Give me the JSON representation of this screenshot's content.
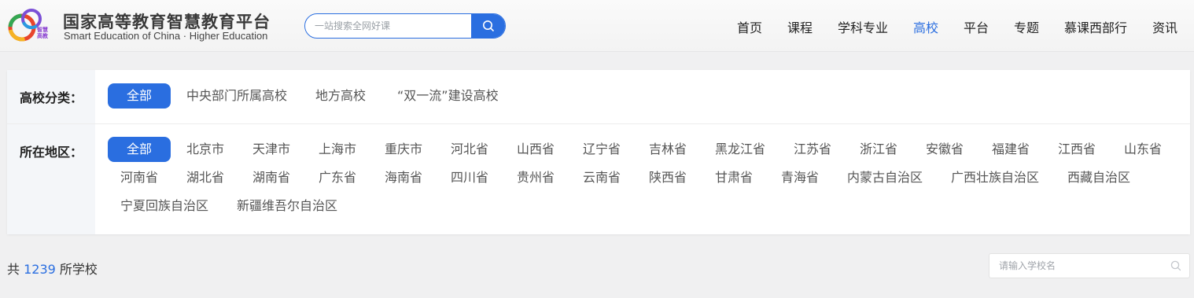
{
  "brand": {
    "title_cn": "国家高等教育智慧教育平台",
    "title_en": "Smart Education of China · Higher Education",
    "logo_text_line1": "智慧",
    "logo_text_line2": "高教"
  },
  "search": {
    "placeholder": "一站搜索全网好课"
  },
  "nav": {
    "items": [
      {
        "label": "首页"
      },
      {
        "label": "课程"
      },
      {
        "label": "学科专业"
      },
      {
        "label": "高校"
      },
      {
        "label": "平台"
      },
      {
        "label": "专题"
      },
      {
        "label": "慕课西部行"
      },
      {
        "label": "资讯"
      }
    ],
    "active_index": 3
  },
  "filters": {
    "category": {
      "label": "高校分类：",
      "options": [
        "全部",
        "中央部门所属高校",
        "地方高校",
        "“双一流”建设高校"
      ],
      "selected": "全部"
    },
    "region": {
      "label": "所在地区：",
      "options": [
        "全部",
        "北京市",
        "天津市",
        "上海市",
        "重庆市",
        "河北省",
        "山西省",
        "辽宁省",
        "吉林省",
        "黑龙江省",
        "江苏省",
        "浙江省",
        "安徽省",
        "福建省",
        "江西省",
        "山东省",
        "河南省",
        "湖北省",
        "湖南省",
        "广东省",
        "海南省",
        "四川省",
        "贵州省",
        "云南省",
        "陕西省",
        "甘肃省",
        "青海省",
        "内蒙古自治区",
        "广西壮族自治区",
        "西藏自治区",
        "宁夏回族自治区",
        "新疆维吾尔自治区"
      ],
      "selected": "全部"
    }
  },
  "results": {
    "prefix": "共",
    "count": "1239",
    "suffix": "所学校"
  },
  "school_search": {
    "placeholder": "请输入学校名"
  },
  "colors": {
    "accent": "#2a6ee0",
    "page_bg": "#f0f0f1",
    "label_col_bg": "#f4f6f9"
  }
}
